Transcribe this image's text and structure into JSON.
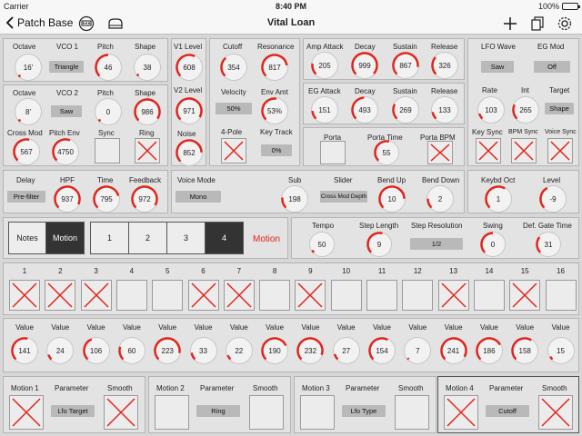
{
  "status": {
    "carrier": "Carrier",
    "time": "8:40 PM",
    "battery": "100%"
  },
  "nav": {
    "back_label": "Patch Base",
    "title": "Vital Loan"
  },
  "vco1": {
    "labels": {
      "octave": "Octave",
      "vco": "VCO 1",
      "pitch": "Pitch",
      "shape": "Shape"
    },
    "octave": "16'",
    "wave": "Triangle",
    "pitch": 46,
    "shape": 38
  },
  "vco2": {
    "labels": {
      "octave": "Octave",
      "vco": "VCO 2",
      "pitch": "Pitch",
      "shape": "Shape",
      "cross_mod": "Cross Mod",
      "pitch_env": "Pitch Env",
      "sync": "Sync",
      "ring": "Ring"
    },
    "octave": "8'",
    "wave": "Saw",
    "pitch": 0,
    "shape": 986,
    "cross_mod": 567,
    "pitch_env": 4750,
    "sync": false,
    "ring": true
  },
  "mixer": {
    "labels": {
      "v1": "V1 Level",
      "v2": "V2 Level",
      "noise": "Noise"
    },
    "v1_level": 608,
    "v2_level": 971,
    "noise": 852
  },
  "filter": {
    "labels": {
      "cutoff": "Cutoff",
      "resonance": "Resonance",
      "velocity": "Velocity",
      "env_amt": "Env Amt",
      "four_pole": "4-Pole",
      "key_track": "Key Track"
    },
    "cutoff": 354,
    "resonance": 817,
    "velocity": "50%",
    "env_amt": "53%",
    "four_pole": true,
    "key_track": "0%"
  },
  "amp_env": {
    "labels": {
      "attack": "Amp Attack",
      "decay": "Decay",
      "sustain": "Sustain",
      "release": "Release"
    },
    "attack": 205,
    "decay": 999,
    "sustain": 867,
    "release": 326
  },
  "eg_env": {
    "labels": {
      "attack": "EG Attack",
      "decay": "Decay",
      "sustain": "Sustain",
      "release": "Release"
    },
    "attack": 151,
    "decay": 493,
    "sustain": 269,
    "release": 133
  },
  "porta": {
    "labels": {
      "porta": "Porta",
      "time": "Porta Time",
      "bpm": "Porta BPM"
    },
    "porta": false,
    "time": 55,
    "bpm": true
  },
  "lfo": {
    "labels": {
      "wave": "LFO Wave",
      "eg_mod": "EG Mod",
      "rate": "Rate",
      "int": "Int",
      "target": "Target",
      "key_sync": "Key Sync",
      "bpm_sync": "BPM Sync",
      "voice_sync": "Voice Sync"
    },
    "wave": "Saw",
    "eg_mod": "Off",
    "rate": 103,
    "int": 265,
    "target": "Shape",
    "key_sync": true,
    "bpm_sync": true,
    "voice_sync": true
  },
  "delay": {
    "labels": {
      "delay": "Delay",
      "hpf": "HPF",
      "time": "Time",
      "feedback": "Feedback"
    },
    "mode": "Pre-filter",
    "hpf": 937,
    "time": 795,
    "feedback": 972
  },
  "voice": {
    "labels": {
      "mode": "Voice Mode",
      "sub": "Sub",
      "slider": "Slider",
      "bend_up": "Bend Up",
      "bend_down": "Bend Down"
    },
    "mode": "Mono",
    "sub": 198,
    "slider": "Cross Mod Depth",
    "bend_up": 10,
    "bend_down": 2
  },
  "keybd": {
    "labels": {
      "oct": "Keybd Oct",
      "level": "Level"
    },
    "oct": 1,
    "level": -9
  },
  "seq_tabs": {
    "notes": "Notes",
    "motion": "Motion",
    "pages": [
      "1",
      "2",
      "3",
      "4"
    ],
    "active_page": 3,
    "mode_label": "Motion"
  },
  "seq_params": {
    "labels": {
      "tempo": "Tempo",
      "step_length": "Step Length",
      "step_res": "Step Resolution",
      "swing": "Swing",
      "gate": "Def. Gate Time"
    },
    "tempo": 50,
    "step_length": 9,
    "step_res": "1/2",
    "swing": 0,
    "gate": 31
  },
  "steps": {
    "numbers": [
      "1",
      "2",
      "3",
      "4",
      "5",
      "6",
      "7",
      "8",
      "9",
      "10",
      "11",
      "12",
      "13",
      "14",
      "15",
      "16"
    ],
    "on": [
      true,
      true,
      true,
      false,
      false,
      true,
      true,
      false,
      true,
      false,
      false,
      false,
      true,
      false,
      true,
      false
    ],
    "value_label": "Value",
    "values": [
      141,
      24,
      106,
      60,
      223,
      33,
      22,
      190,
      232,
      27,
      154,
      7,
      241,
      186,
      158,
      15
    ]
  },
  "motion_slots": [
    {
      "title": "Motion 1",
      "param_label": "Parameter",
      "param": "Lfo Target",
      "smooth_label": "Smooth",
      "on": true,
      "smooth": true
    },
    {
      "title": "Motion 2",
      "param_label": "Parameter",
      "param": "Ring",
      "smooth_label": "Smooth",
      "on": false,
      "smooth": false
    },
    {
      "title": "Motion 3",
      "param_label": "Parameter",
      "param": "Lfo Type",
      "smooth_label": "Smooth",
      "on": false,
      "smooth": false
    },
    {
      "title": "Motion 4",
      "param_label": "Parameter",
      "param": "Cutoff",
      "smooth_label": "Smooth",
      "on": true,
      "smooth": true
    }
  ],
  "colors": {
    "accent": "#e2231a",
    "panel": "#e3e3e3",
    "background": "#d7d7d7"
  }
}
